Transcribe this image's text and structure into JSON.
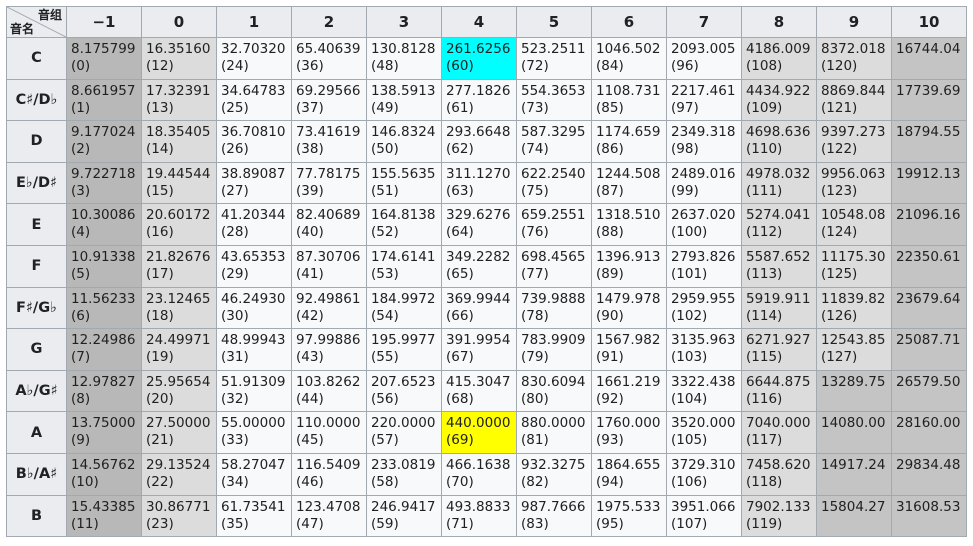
{
  "corner": {
    "top": "音组",
    "bottom": "音名"
  },
  "octaves": [
    "−1",
    "0",
    "1",
    "2",
    "3",
    "4",
    "5",
    "6",
    "7",
    "8",
    "9",
    "10"
  ],
  "rows": [
    {
      "note": "C",
      "cells": [
        [
          "8.175799",
          "(0)"
        ],
        [
          "16.35160",
          "(12)"
        ],
        [
          "32.70320",
          "(24)"
        ],
        [
          "65.40639",
          "(36)"
        ],
        [
          "130.8128",
          "(48)"
        ],
        [
          "261.6256",
          "(60)"
        ],
        [
          "523.2511",
          "(72)"
        ],
        [
          "1046.502",
          "(84)"
        ],
        [
          "2093.005",
          "(96)"
        ],
        [
          "4186.009",
          "(108)"
        ],
        [
          "8372.018",
          "(120)"
        ],
        [
          "16744.04",
          ""
        ]
      ]
    },
    {
      "note": "C♯/D♭",
      "cells": [
        [
          "8.661957",
          "(1)"
        ],
        [
          "17.32391",
          "(13)"
        ],
        [
          "34.64783",
          "(25)"
        ],
        [
          "69.29566",
          "(37)"
        ],
        [
          "138.5913",
          "(49)"
        ],
        [
          "277.1826",
          "(61)"
        ],
        [
          "554.3653",
          "(73)"
        ],
        [
          "1108.731",
          "(85)"
        ],
        [
          "2217.461",
          "(97)"
        ],
        [
          "4434.922",
          "(109)"
        ],
        [
          "8869.844",
          "(121)"
        ],
        [
          "17739.69",
          ""
        ]
      ]
    },
    {
      "note": "D",
      "cells": [
        [
          "9.177024",
          "(2)"
        ],
        [
          "18.35405",
          "(14)"
        ],
        [
          "36.70810",
          "(26)"
        ],
        [
          "73.41619",
          "(38)"
        ],
        [
          "146.8324",
          "(50)"
        ],
        [
          "293.6648",
          "(62)"
        ],
        [
          "587.3295",
          "(74)"
        ],
        [
          "1174.659",
          "(86)"
        ],
        [
          "2349.318",
          "(98)"
        ],
        [
          "4698.636",
          "(110)"
        ],
        [
          "9397.273",
          "(122)"
        ],
        [
          "18794.55",
          ""
        ]
      ]
    },
    {
      "note": "E♭/D♯",
      "cells": [
        [
          "9.722718",
          "(3)"
        ],
        [
          "19.44544",
          "(15)"
        ],
        [
          "38.89087",
          "(27)"
        ],
        [
          "77.78175",
          "(39)"
        ],
        [
          "155.5635",
          "(51)"
        ],
        [
          "311.1270",
          "(63)"
        ],
        [
          "622.2540",
          "(75)"
        ],
        [
          "1244.508",
          "(87)"
        ],
        [
          "2489.016",
          "(99)"
        ],
        [
          "4978.032",
          "(111)"
        ],
        [
          "9956.063",
          "(123)"
        ],
        [
          "19912.13",
          ""
        ]
      ]
    },
    {
      "note": "E",
      "cells": [
        [
          "10.30086",
          "(4)"
        ],
        [
          "20.60172",
          "(16)"
        ],
        [
          "41.20344",
          "(28)"
        ],
        [
          "82.40689",
          "(40)"
        ],
        [
          "164.8138",
          "(52)"
        ],
        [
          "329.6276",
          "(64)"
        ],
        [
          "659.2551",
          "(76)"
        ],
        [
          "1318.510",
          "(88)"
        ],
        [
          "2637.020",
          "(100)"
        ],
        [
          "5274.041",
          "(112)"
        ],
        [
          "10548.08",
          "(124)"
        ],
        [
          "21096.16",
          ""
        ]
      ]
    },
    {
      "note": "F",
      "cells": [
        [
          "10.91338",
          "(5)"
        ],
        [
          "21.82676",
          "(17)"
        ],
        [
          "43.65353",
          "(29)"
        ],
        [
          "87.30706",
          "(41)"
        ],
        [
          "174.6141",
          "(53)"
        ],
        [
          "349.2282",
          "(65)"
        ],
        [
          "698.4565",
          "(77)"
        ],
        [
          "1396.913",
          "(89)"
        ],
        [
          "2793.826",
          "(101)"
        ],
        [
          "5587.652",
          "(113)"
        ],
        [
          "11175.30",
          "(125)"
        ],
        [
          "22350.61",
          ""
        ]
      ]
    },
    {
      "note": "F♯/G♭",
      "cells": [
        [
          "11.56233",
          "(6)"
        ],
        [
          "23.12465",
          "(18)"
        ],
        [
          "46.24930",
          "(30)"
        ],
        [
          "92.49861",
          "(42)"
        ],
        [
          "184.9972",
          "(54)"
        ],
        [
          "369.9944",
          "(66)"
        ],
        [
          "739.9888",
          "(78)"
        ],
        [
          "1479.978",
          "(90)"
        ],
        [
          "2959.955",
          "(102)"
        ],
        [
          "5919.911",
          "(114)"
        ],
        [
          "11839.82",
          "(126)"
        ],
        [
          "23679.64",
          ""
        ]
      ]
    },
    {
      "note": "G",
      "cells": [
        [
          "12.24986",
          "(7)"
        ],
        [
          "24.49971",
          "(19)"
        ],
        [
          "48.99943",
          "(31)"
        ],
        [
          "97.99886",
          "(43)"
        ],
        [
          "195.9977",
          "(55)"
        ],
        [
          "391.9954",
          "(67)"
        ],
        [
          "783.9909",
          "(79)"
        ],
        [
          "1567.982",
          "(91)"
        ],
        [
          "3135.963",
          "(103)"
        ],
        [
          "6271.927",
          "(115)"
        ],
        [
          "12543.85",
          "(127)"
        ],
        [
          "25087.71",
          ""
        ]
      ]
    },
    {
      "note": "A♭/G♯",
      "cells": [
        [
          "12.97827",
          "(8)"
        ],
        [
          "25.95654",
          "(20)"
        ],
        [
          "51.91309",
          "(32)"
        ],
        [
          "103.8262",
          "(44)"
        ],
        [
          "207.6523",
          "(56)"
        ],
        [
          "415.3047",
          "(68)"
        ],
        [
          "830.6094",
          "(80)"
        ],
        [
          "1661.219",
          "(92)"
        ],
        [
          "3322.438",
          "(104)"
        ],
        [
          "6644.875",
          "(116)"
        ],
        [
          "13289.75",
          ""
        ],
        [
          "26579.50",
          ""
        ]
      ]
    },
    {
      "note": "A",
      "cells": [
        [
          "13.75000",
          "(9)"
        ],
        [
          "27.50000",
          "(21)"
        ],
        [
          "55.00000",
          "(33)"
        ],
        [
          "110.0000",
          "(45)"
        ],
        [
          "220.0000",
          "(57)"
        ],
        [
          "440.0000",
          "(69)"
        ],
        [
          "880.0000",
          "(81)"
        ],
        [
          "1760.000",
          "(93)"
        ],
        [
          "3520.000",
          "(105)"
        ],
        [
          "7040.000",
          "(117)"
        ],
        [
          "14080.00",
          ""
        ],
        [
          "28160.00",
          ""
        ]
      ]
    },
    {
      "note": "B♭/A♯",
      "cells": [
        [
          "14.56762",
          "(10)"
        ],
        [
          "29.13524",
          "(22)"
        ],
        [
          "58.27047",
          "(34)"
        ],
        [
          "116.5409",
          "(46)"
        ],
        [
          "233.0819",
          "(58)"
        ],
        [
          "466.1638",
          "(70)"
        ],
        [
          "932.3275",
          "(82)"
        ],
        [
          "1864.655",
          "(94)"
        ],
        [
          "3729.310",
          "(106)"
        ],
        [
          "7458.620",
          "(118)"
        ],
        [
          "14917.24",
          ""
        ],
        [
          "29834.48",
          ""
        ]
      ]
    },
    {
      "note": "B",
      "cells": [
        [
          "15.43385",
          "(11)"
        ],
        [
          "30.86771",
          "(23)"
        ],
        [
          "61.73541",
          "(35)"
        ],
        [
          "123.4708",
          "(47)"
        ],
        [
          "246.9417",
          "(59)"
        ],
        [
          "493.8833",
          "(71)"
        ],
        [
          "987.7666",
          "(83)"
        ],
        [
          "1975.533",
          "(95)"
        ],
        [
          "3951.066",
          "(107)"
        ],
        [
          "7902.133",
          "(119)"
        ],
        [
          "15804.27",
          ""
        ],
        [
          "31608.53",
          ""
        ]
      ]
    }
  ],
  "highlights": {
    "cyan": [
      0,
      5
    ],
    "yellow": [
      9,
      5
    ]
  }
}
